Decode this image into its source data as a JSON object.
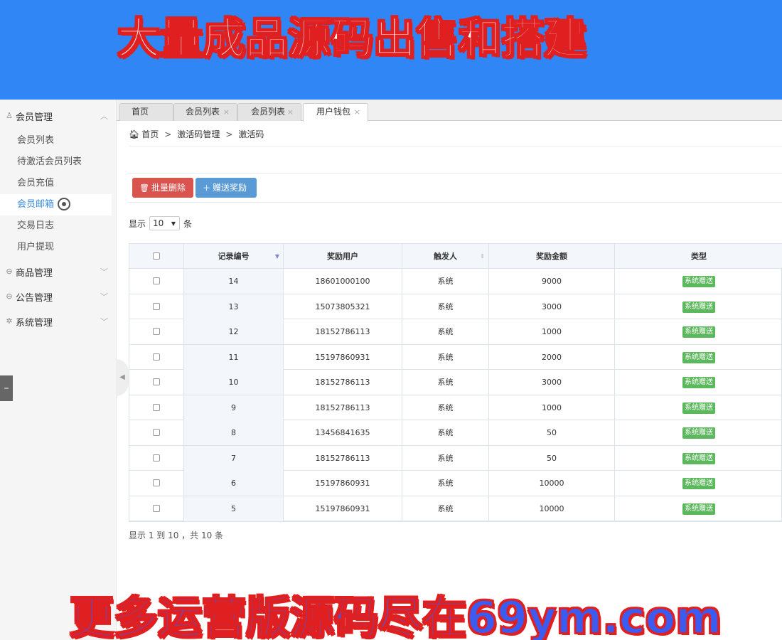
{
  "banner": {
    "top_text": "大量成品源码出售和搭建",
    "bottom_text": "更多运营版源码尽在69ym.com"
  },
  "sidebar": {
    "groups": [
      {
        "label": "会员管理",
        "icon": "user-icon",
        "arrow": "chevron-up-icon"
      },
      {
        "label": "商品管理",
        "icon": "minus-circle-icon",
        "arrow": "chevron-down-icon"
      },
      {
        "label": "公告管理",
        "icon": "minus-circle-icon",
        "arrow": "chevron-down-icon"
      },
      {
        "label": "系统管理",
        "icon": "gear-icon",
        "arrow": "chevron-down-icon"
      }
    ],
    "items": [
      {
        "label": "会员列表"
      },
      {
        "label": "待激活会员列表"
      },
      {
        "label": "会员充值"
      },
      {
        "label": "会员邮箱"
      },
      {
        "label": "交易日志"
      },
      {
        "label": "用户提现"
      }
    ],
    "collapse_glyph": "–"
  },
  "tabs": [
    {
      "label": "首页"
    },
    {
      "label": "会员列表"
    },
    {
      "label": "会员列表"
    },
    {
      "label": "用户钱包"
    }
  ],
  "tab_close_glyph": "×",
  "breadcrumb": [
    "首页",
    "激活码管理",
    "激活码"
  ],
  "breadcrumb_sep": ">",
  "toolbar": {
    "delete_label": "批量删除",
    "reward_label": "赠送奖励",
    "delete_color": "#d9534f",
    "reward_color": "#5b9bd5"
  },
  "page_size": {
    "prefix": "显示",
    "value": "10",
    "suffix": "条"
  },
  "table": {
    "headers": [
      "记录编号",
      "奖励用户",
      "触发人",
      "奖励金额",
      "类型"
    ],
    "rows": [
      {
        "id": "14",
        "user": "18601000100",
        "trigger": "系统",
        "amount": "9000",
        "type": "系统赠送"
      },
      {
        "id": "13",
        "user": "15073805321",
        "trigger": "系统",
        "amount": "3000",
        "type": "系统赠送"
      },
      {
        "id": "12",
        "user": "18152786113",
        "trigger": "系统",
        "amount": "1000",
        "type": "系统赠送"
      },
      {
        "id": "11",
        "user": "15197860931",
        "trigger": "系统",
        "amount": "2000",
        "type": "系统赠送"
      },
      {
        "id": "10",
        "user": "18152786113",
        "trigger": "系统",
        "amount": "3000",
        "type": "系统赠送"
      },
      {
        "id": "9",
        "user": "18152786113",
        "trigger": "系统",
        "amount": "1000",
        "type": "系统赠送"
      },
      {
        "id": "8",
        "user": "13456841635",
        "trigger": "系统",
        "amount": "50",
        "type": "系统赠送"
      },
      {
        "id": "7",
        "user": "18152786113",
        "trigger": "系统",
        "amount": "50",
        "type": "系统赠送"
      },
      {
        "id": "6",
        "user": "15197860931",
        "trigger": "系统",
        "amount": "10000",
        "type": "系统赠送"
      },
      {
        "id": "5",
        "user": "15197860931",
        "trigger": "系统",
        "amount": "10000",
        "type": "系统赠送"
      }
    ],
    "badge_color": "#5cb85c"
  },
  "summary": "显示 1 到 10 ，共 10 条"
}
